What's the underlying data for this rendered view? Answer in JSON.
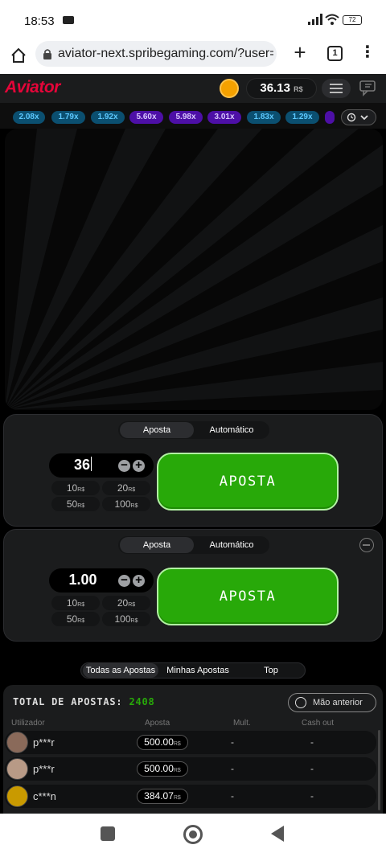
{
  "status_bar": {
    "time": "18:53",
    "battery": "72"
  },
  "browser": {
    "url": "aviator-next.spribegaming.com/?user=4",
    "tab_count": "1"
  },
  "app": {
    "logo": "Aviator",
    "balance": "36.13",
    "currency": "R$"
  },
  "history": [
    "2.08x",
    "1.79x",
    "1.92x",
    "5.60x",
    "5.98x",
    "3.01x",
    "1.83x",
    "1.29x"
  ],
  "bet_panels": [
    {
      "mode_tabs": [
        "Aposta",
        "Automático"
      ],
      "amount": "36",
      "quick_amounts": [
        "10",
        "20",
        "50",
        "100"
      ],
      "bet_label": "APOSTA"
    },
    {
      "mode_tabs": [
        "Aposta",
        "Automático"
      ],
      "amount": "1.00",
      "quick_amounts": [
        "10",
        "20",
        "50",
        "100"
      ],
      "bet_label": "APOSTA"
    }
  ],
  "list_tabs": [
    "Todas as Apostas",
    "Minhas Apostas",
    "Top"
  ],
  "bets": {
    "total_label": "TOTAL DE APOSTAS:",
    "total_count": "2408",
    "prev_label": "Mão anterior",
    "columns": [
      "Utilizador",
      "Aposta",
      "Mult.",
      "Cash out"
    ],
    "rows": [
      {
        "user": "p***r",
        "bet": "500.00",
        "mult": "-",
        "cashout": "-"
      },
      {
        "user": "p***r",
        "bet": "500.00",
        "mult": "-",
        "cashout": "-"
      },
      {
        "user": "c***n",
        "bet": "384.07",
        "mult": "-",
        "cashout": "-"
      }
    ]
  },
  "colors": {
    "accent_green": "#28a909",
    "brand_red": "#e50539",
    "purple": "#4d0fa6",
    "blue": "#0b4f70"
  }
}
